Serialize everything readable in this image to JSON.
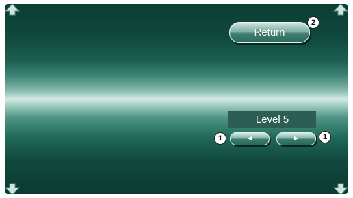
{
  "header": {
    "return_label": "Return",
    "return_badge": "2"
  },
  "level": {
    "value_label": "Level 5",
    "decrease_glyph": "◄",
    "increase_glyph": "►",
    "decrease_badge": "1",
    "increase_badge": "1"
  },
  "colors": {
    "background_dark": "#0c3d33",
    "band_light": "#d5ece4",
    "button_face": "#7fb1a4",
    "level_box": "#2c5e54"
  },
  "icons": {
    "corners": [
      "arrow-up-icon",
      "arrow-up-icon",
      "arrow-down-icon",
      "arrow-down-icon"
    ]
  }
}
